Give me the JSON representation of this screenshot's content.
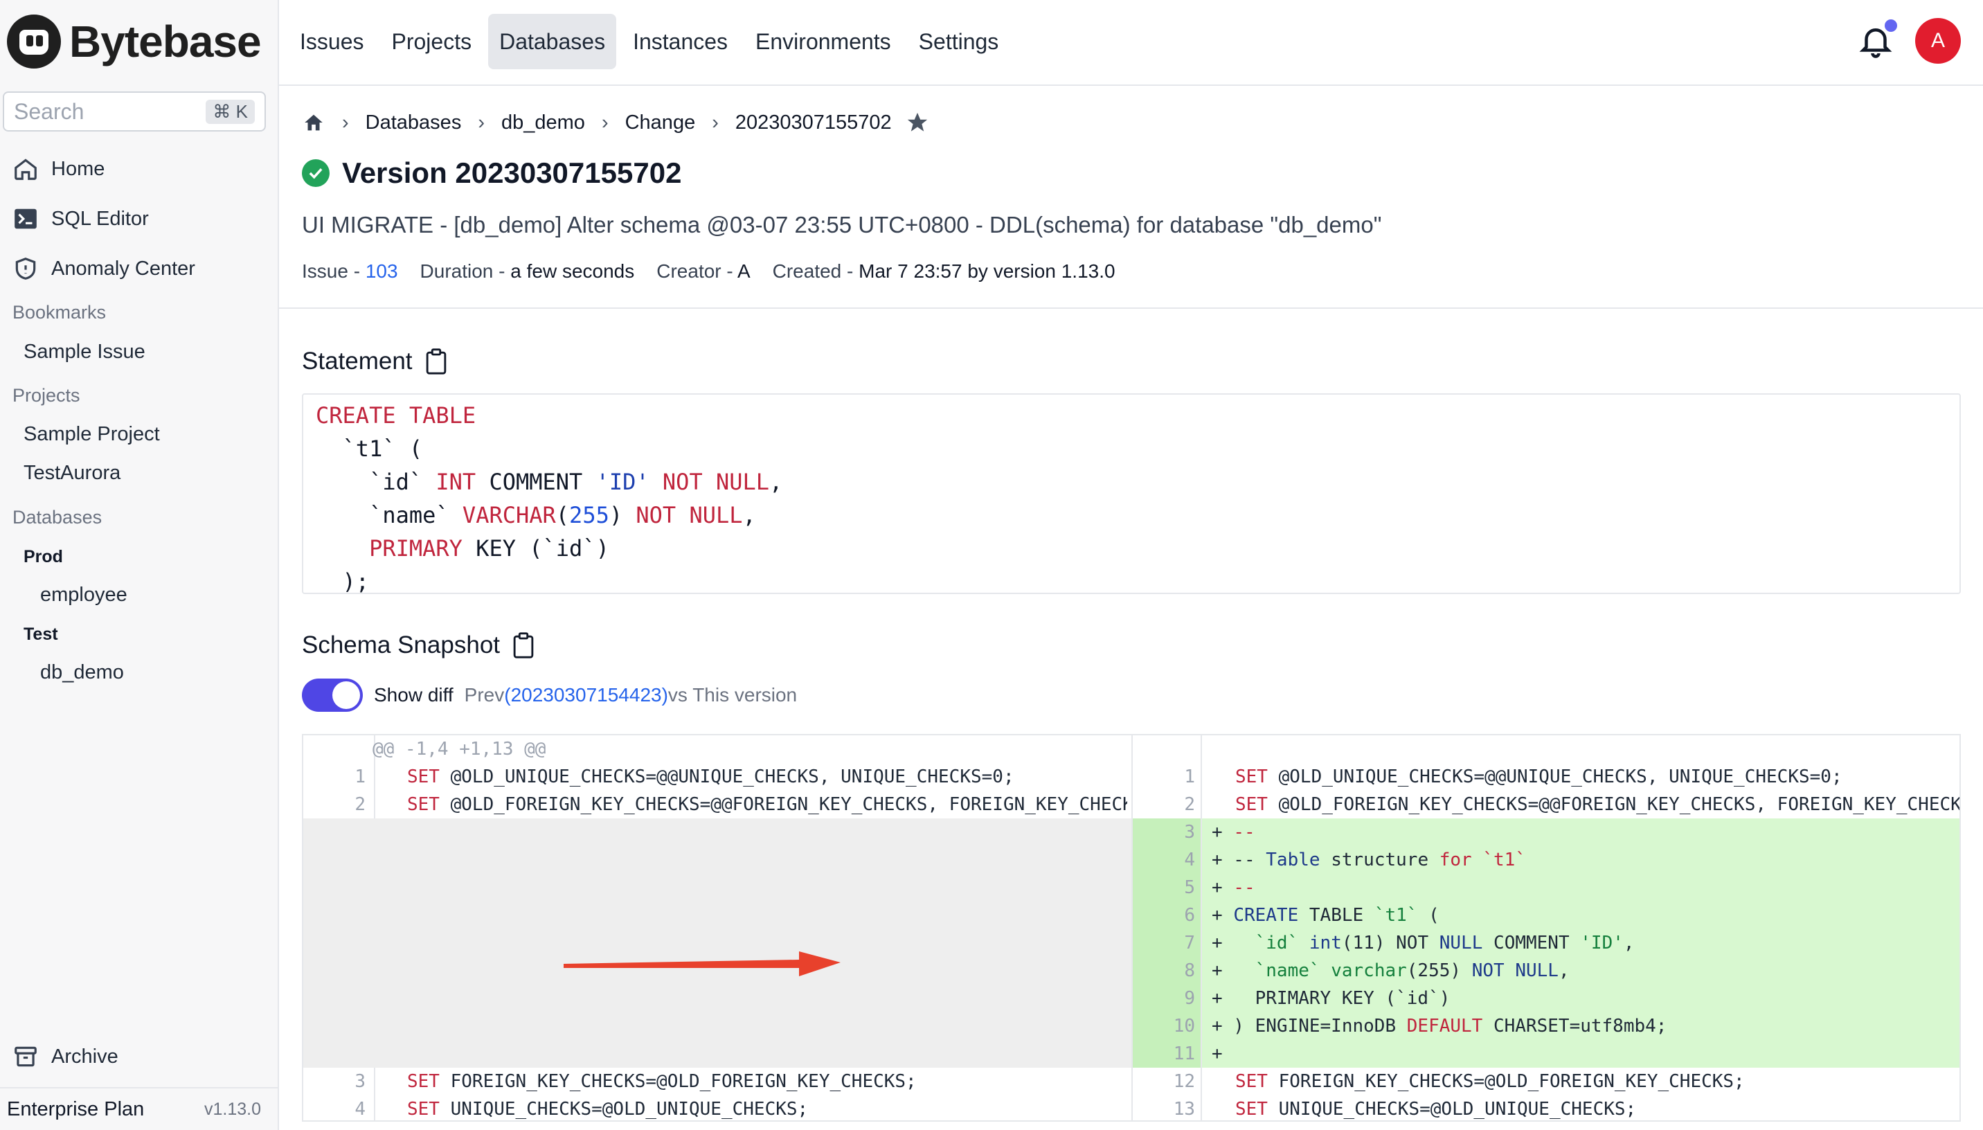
{
  "app": {
    "logo_text": "Bytebase",
    "search_placeholder": "Search",
    "search_shortcut": "⌘ K",
    "version": "v1.13.0",
    "plan": "Enterprise Plan"
  },
  "sidebar": {
    "nav": [
      {
        "label": "Home",
        "icon": "home-icon"
      },
      {
        "label": "SQL Editor",
        "icon": "terminal-icon"
      },
      {
        "label": "Anomaly Center",
        "icon": "shield-icon"
      }
    ],
    "bookmarks_label": "Bookmarks",
    "bookmarks": [
      "Sample Issue"
    ],
    "projects_label": "Projects",
    "projects": [
      "Sample Project",
      "TestAurora"
    ],
    "databases_label": "Databases",
    "environments": [
      {
        "name": "Prod",
        "databases": [
          "employee"
        ]
      },
      {
        "name": "Test",
        "databases": [
          "db_demo"
        ]
      }
    ],
    "archive_label": "Archive"
  },
  "topbar": {
    "tabs": [
      "Issues",
      "Projects",
      "Databases",
      "Instances",
      "Environments",
      "Settings"
    ],
    "active_tab": "Databases",
    "avatar_initial": "A"
  },
  "breadcrumb": [
    "Databases",
    "db_demo",
    "Change",
    "20230307155702"
  ],
  "header": {
    "title": "Version 20230307155702",
    "subtitle": "UI MIGRATE - [db_demo] Alter schema @03-07 23:55 UTC+0800 - DDL(schema) for database \"db_demo\"",
    "issue_label": "Issue - ",
    "issue_value": "103",
    "duration_label": "Duration - ",
    "duration_value": "a few seconds",
    "creator_label": "Creator - ",
    "creator_value": "A",
    "created_label": "Created - ",
    "created_value": "Mar 7 23:57 by version 1.13.0"
  },
  "statement": {
    "title": "Statement"
  },
  "snapshot": {
    "title": "Schema Snapshot",
    "show_diff_label": "Show diff",
    "prev_prefix": "Prev ",
    "prev_link": "(20230307154423)",
    "prev_suffix": " vs This version",
    "hunk_header": "@@ -1,4 +1,13 @@"
  },
  "colors": {
    "accent": "#4f46e5",
    "danger": "#e11d2e",
    "success": "#22a35a",
    "diff_add": "#d8f8d0"
  }
}
